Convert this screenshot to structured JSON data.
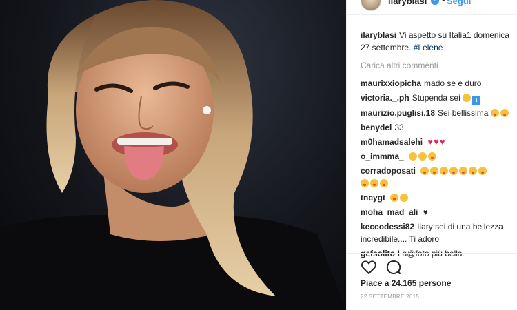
{
  "post": {
    "author": "ilaryblasi",
    "follow_label": "Segui",
    "caption_user": "ilaryblasi",
    "caption_text": "Vi aspetto su Italia1 domenica 27 settembre. ",
    "caption_tag": "#Lelene",
    "load_more": "Carica altri commenti",
    "likes": "Piace a 24.165 persone",
    "date": "22 SETTEMBRE 2015"
  },
  "comments": [
    {
      "user": "maurixxiopicha",
      "text": "mado se e duro"
    },
    {
      "user": "victoria._.ph",
      "text": "Stupenda sei"
    },
    {
      "user": "maurizio.puglisi.18",
      "text": "Sei bellissima"
    },
    {
      "user": "benydel",
      "text": "33"
    },
    {
      "user": "m0hamadsalehi",
      "text": ""
    },
    {
      "user": "o_immma_",
      "text": ""
    },
    {
      "user": "corradoposati",
      "text": ""
    },
    {
      "user": "tncygt",
      "text": ""
    },
    {
      "user": "moha_mad_ali",
      "text": ""
    },
    {
      "user": "keccodessi82",
      "text": "Ilary sei di una bellezza incredibile.... Ti adoro"
    },
    {
      "user": "gefsolito",
      "text": "La@foto più bella"
    }
  ],
  "icons": {
    "like": "heart-outline-icon",
    "comment": "speech-bubble-icon",
    "verified": "verified-badge-icon"
  },
  "colors": {
    "link": "#3897f0",
    "text": "#262626",
    "muted": "#999999"
  }
}
